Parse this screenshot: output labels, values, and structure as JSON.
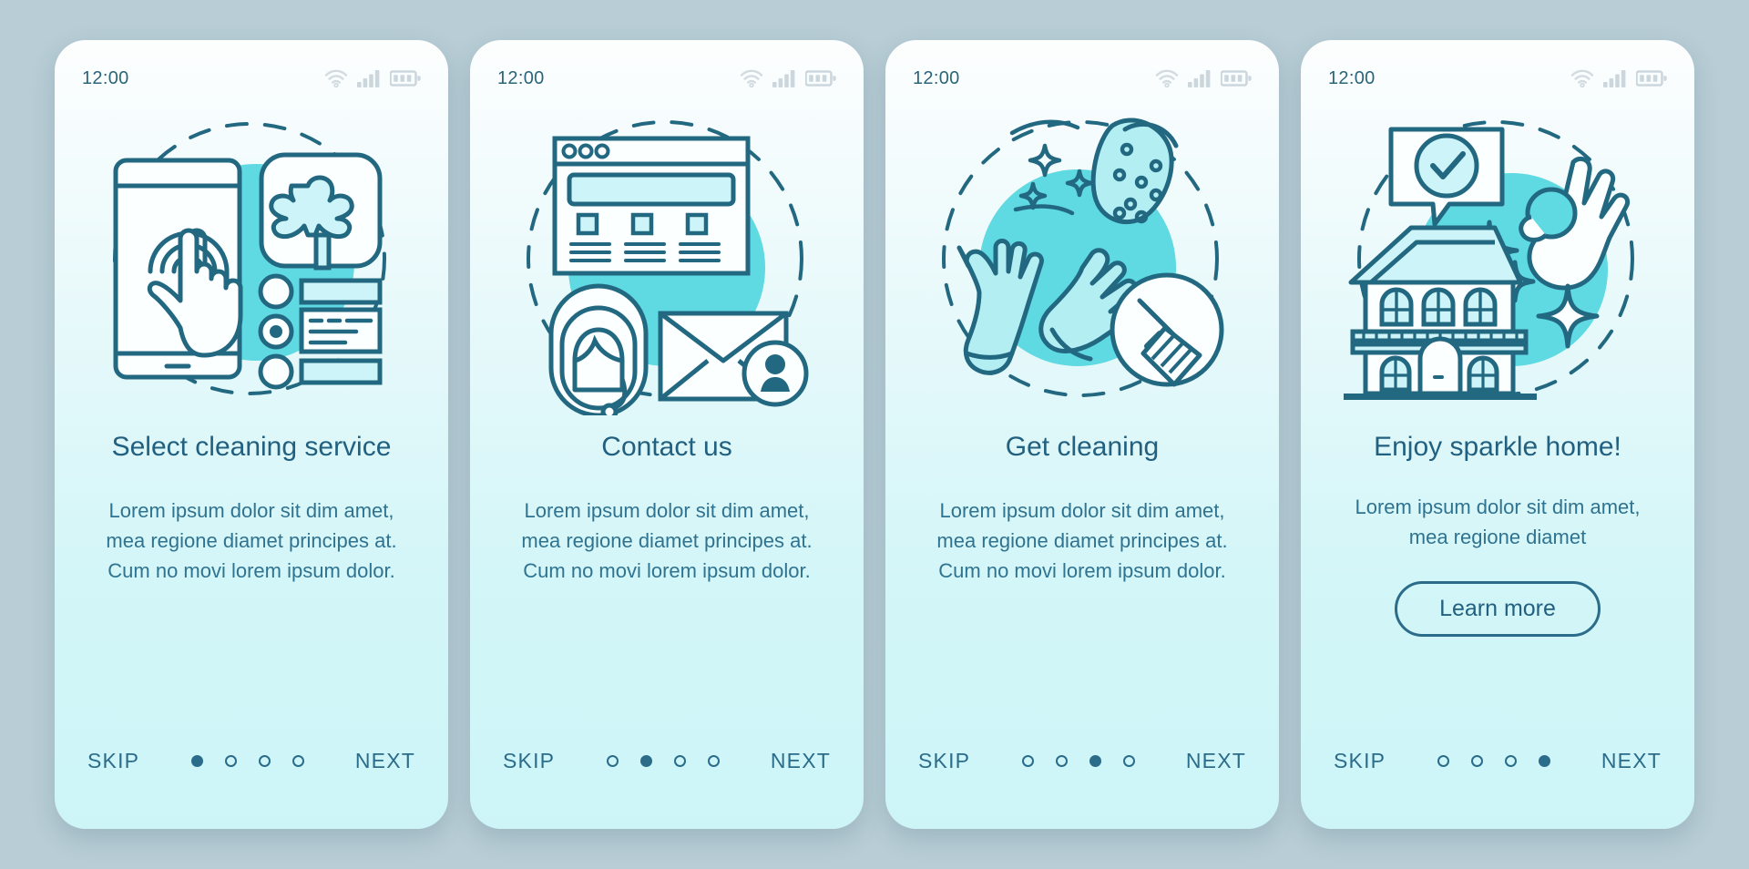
{
  "theme": {
    "page_bg": "#b8cdd6",
    "card_bg_top": "#fdfefe",
    "card_bg_bottom": "#cdf5f8",
    "accent": "#2b6c8a",
    "title_color": "#226080",
    "body_color": "#2f7390",
    "blob": "#62dbe3",
    "line": "#236881"
  },
  "status_bar": {
    "time": "12:00",
    "wifi_icon": "wifi-icon",
    "signal_icon": "signal-bars-icon",
    "battery_icon": "battery-icon",
    "battery_segments": 3,
    "signal_bars": 4
  },
  "nav": {
    "skip_label": "SKIP",
    "next_label": "NEXT",
    "dot_count": 4
  },
  "screens": [
    {
      "id": "select-cleaning-service",
      "illustration": "phone-tap-duster-options-illustration",
      "title": "Select cleaning service",
      "body": "Lorem ipsum dolor sit dim amet, mea regione diamet principes at. Cum no movi lorem ipsum dolor.",
      "active_dot": 0,
      "has_learn_more": false,
      "learn_more_label": ""
    },
    {
      "id": "contact-us",
      "illustration": "browser-support-agent-envelope-illustration",
      "title": "Contact us",
      "body": "Lorem ipsum dolor sit dim amet, mea regione diamet principes at. Cum no movi lorem ipsum dolor.",
      "active_dot": 1,
      "has_learn_more": false,
      "learn_more_label": ""
    },
    {
      "id": "get-cleaning",
      "illustration": "gloves-sponge-broom-illustration",
      "title": "Get cleaning",
      "body": "Lorem ipsum dolor sit dim amet, mea regione diamet principes at. Cum no movi lorem ipsum dolor.",
      "active_dot": 2,
      "has_learn_more": false,
      "learn_more_label": ""
    },
    {
      "id": "enjoy-sparkle-home",
      "illustration": "house-checkmark-ok-hand-illustration",
      "title": "Enjoy sparkle home!",
      "body": "Lorem ipsum dolor sit dim amet, mea regione diamet",
      "active_dot": 3,
      "has_learn_more": true,
      "learn_more_label": "Learn more"
    }
  ]
}
